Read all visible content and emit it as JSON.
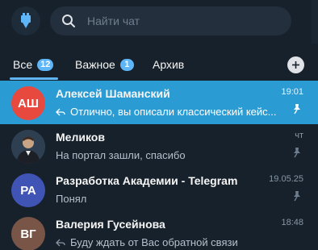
{
  "search": {
    "placeholder": "Найти чат"
  },
  "tabs": [
    {
      "label": "Все",
      "badge": "12"
    },
    {
      "label": "Важное",
      "badge": "1"
    },
    {
      "label": "Архив"
    }
  ],
  "chats": [
    {
      "avatar": "АШ",
      "avatar_color": "#e8493f",
      "name": "Алексей Шаманский",
      "time": "19:01",
      "preview": "Отлично, вы описали классический кейс...",
      "reply": true,
      "pinned": true,
      "active": true
    },
    {
      "avatar": "",
      "avatar_color": "#3a4a5c",
      "name": "Меликов",
      "time": "чт",
      "preview": "На портал зашли, спасибо",
      "reply": false,
      "pinned": true,
      "active": false
    },
    {
      "avatar": "РА",
      "avatar_color": "#3f54b5",
      "name": "Разработка Академии - Telegram",
      "time": "19.05.25",
      "preview": "Понял",
      "reply": false,
      "pinned": true,
      "active": false
    },
    {
      "avatar": "ВГ",
      "avatar_color": "#795548",
      "name": "Валерия Гусейнова",
      "time": "18:48",
      "preview": "Буду ждать от Вас обратной связи",
      "reply": true,
      "pinned": false,
      "active": false
    }
  ]
}
